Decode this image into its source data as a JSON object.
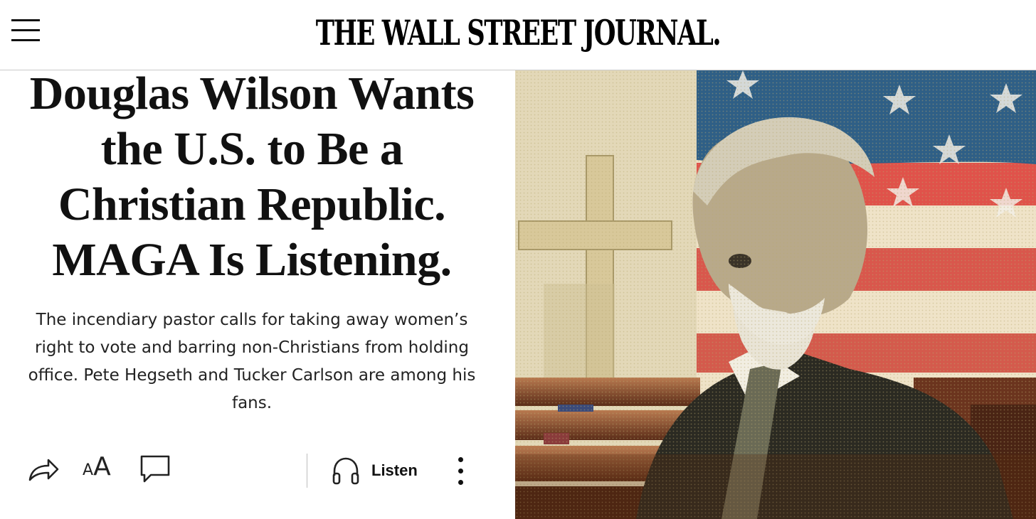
{
  "header": {
    "menu_icon": "hamburger-menu-icon",
    "masthead": "THE WALL STREET JOURNAL."
  },
  "article": {
    "headline_lines": [
      "Douglas Wilson Wants",
      "the U.S. to Be a",
      "Christian Republic.",
      "MAGA Is Listening."
    ],
    "dek": "The incendiary pastor calls for taking away women’s right to vote and barring non-Christians from holding office. Pete Hegseth and Tucker Carlson are among his fans."
  },
  "toolbar": {
    "share_icon": "share-arrow-icon",
    "text_size_small": "A",
    "text_size_large": "A",
    "comment_icon": "comment-bubble-icon",
    "listen_icon": "headphones-icon",
    "listen_label": "Listen",
    "more_icon": "vertical-ellipsis-icon"
  },
  "colors": {
    "text": "#111111",
    "divider": "#c9c9c9",
    "flag_blue": "#2f5f86",
    "flag_red": "#e0524a",
    "sepia": "#d9c99a"
  }
}
